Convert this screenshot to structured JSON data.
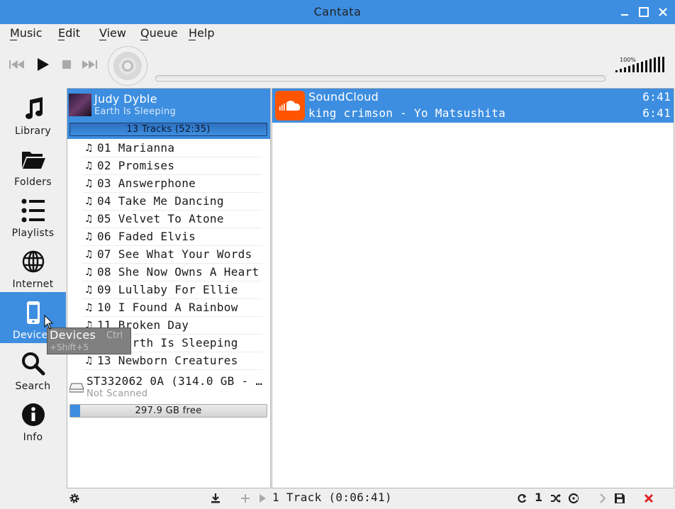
{
  "window": {
    "title": "Cantata"
  },
  "menu": [
    "Music",
    "Edit",
    "View",
    "Queue",
    "Help"
  ],
  "toolbar": {
    "prev_icon": "skip-back-icon",
    "play_icon": "play-icon",
    "stop_icon": "stop-icon",
    "next_icon": "skip-forward-icon",
    "volume_label": "100%",
    "volume_level": 1.0
  },
  "sidenav": [
    {
      "label": "Library",
      "icon": "music-note-icon",
      "active": false
    },
    {
      "label": "Folders",
      "icon": "folder-icon",
      "active": false
    },
    {
      "label": "Playlists",
      "icon": "list-icon",
      "active": false
    },
    {
      "label": "Internet",
      "icon": "globe-icon",
      "active": false
    },
    {
      "label": "Devices",
      "icon": "phone-icon",
      "active": true
    },
    {
      "label": "Search",
      "icon": "search-icon",
      "active": false
    },
    {
      "label": "Info",
      "icon": "info-icon",
      "active": false
    }
  ],
  "album": {
    "artist": "Judy Dyble",
    "title": "Earth Is Sleeping",
    "count": "13 Tracks (52:35)"
  },
  "tracks": [
    "01 Marianna",
    "02 Promises",
    "03 Answerphone",
    "04 Take Me Dancing",
    "05 Velvet To Atone",
    "06 Faded Elvis",
    "07 See What Your Words",
    "08 She Now Owns A Heart",
    "09 Lullaby For Ellie",
    "10 I Found A Rainbow",
    "11 Broken Day",
    "12 Earth Is Sleeping",
    "13 Newborn Creatures"
  ],
  "device": {
    "name": "ST332062 0A (314.0 GB - ...",
    "status": "Not Scanned",
    "free": "297.9 GB free",
    "used_fraction": 0.05
  },
  "queue": {
    "source": "SoundCloud",
    "source_duration": "6:41",
    "track": "king crimson - Yo Matsushita",
    "track_duration": "6:41"
  },
  "statusbar": {
    "text": "1 Track (0:06:41)",
    "single_label": "1"
  },
  "tooltip": {
    "title": "Devices",
    "shortcut_a": "Ctrl",
    "shortcut_b": "+Shift+5"
  },
  "colors": {
    "accent": "#3d8ee0",
    "titlebar": "#3d8ee0",
    "soundcloud": "#ff5500",
    "stop_red": "#e02020"
  }
}
